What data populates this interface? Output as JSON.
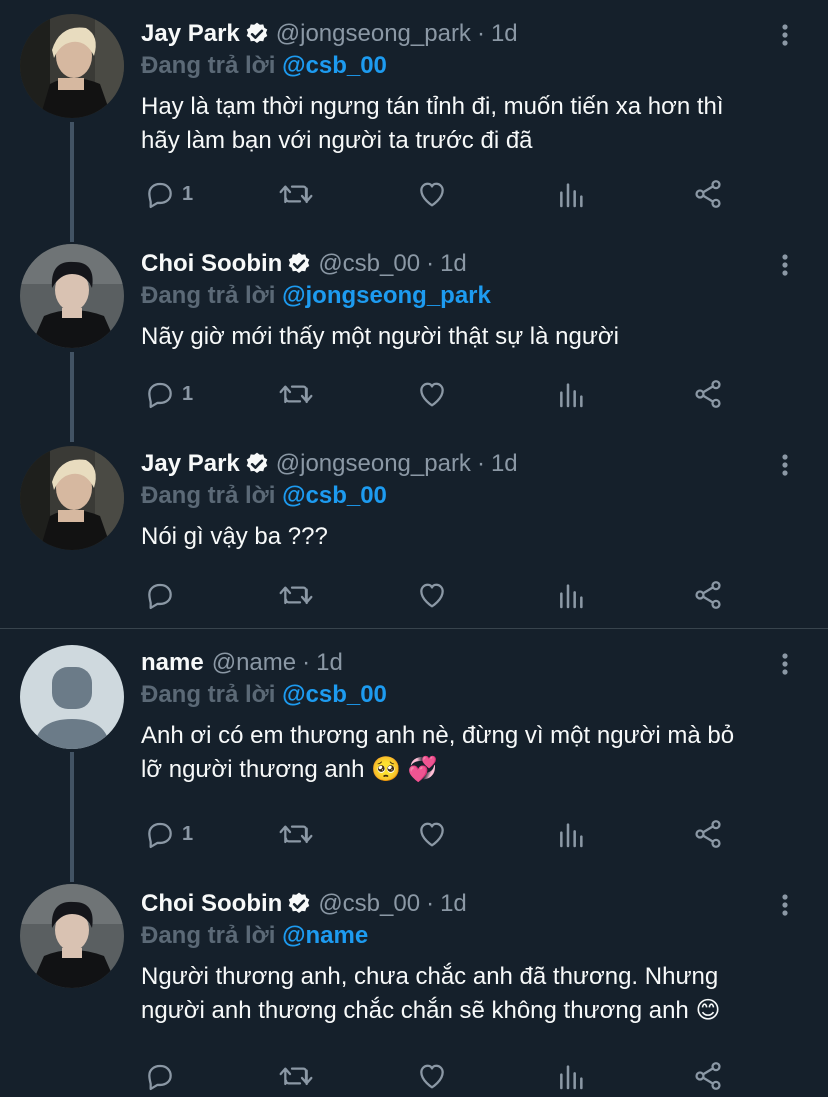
{
  "tweets": [
    {
      "name": "Jay Park",
      "handle": "@jongseong_park",
      "dot": "·",
      "time": "1d",
      "reply_prefix": "Đang trả lời",
      "reply_to": "@csb_00",
      "lines": [
        "Hay là tạm thời ngưng tán tỉnh đi, muốn tiến xa hơn thì",
        "hãy làm bạn với người ta trước đi đã"
      ],
      "reply_count": "1",
      "avatar": "blonde-man-avatar"
    },
    {
      "name": "Choi Soobin",
      "handle": "@csb_00",
      "dot": "·",
      "time": "1d",
      "reply_prefix": "Đang trả lời",
      "reply_to": "@jongseong_park",
      "lines": [
        "Nãy giờ mới thấy một người thật sự là người"
      ],
      "reply_count": "1",
      "avatar": "dark-hair-man-avatar"
    },
    {
      "name": "Jay Park",
      "handle": "@jongseong_park",
      "dot": "·",
      "time": "1d",
      "reply_prefix": "Đang trả lời",
      "reply_to": "@csb_00",
      "lines": [
        "Nói gì vậy ba ???"
      ],
      "reply_count": "",
      "avatar": "blonde-man-avatar"
    },
    {
      "name": "name",
      "handle": "@name",
      "dot": "·",
      "time": "1d",
      "reply_prefix": "Đang trả lời",
      "reply_to": "@csb_00",
      "lines": [
        "Anh ơi có em thương anh nè, đừng vì một người mà bỏ",
        "lỡ người thương anh 🥺 💞"
      ],
      "reply_count": "1",
      "avatar": "default-user-avatar"
    },
    {
      "name": "Choi Soobin",
      "handle": "@csb_00",
      "dot": "·",
      "time": "1d",
      "reply_prefix": "Đang trả lời",
      "reply_to": "@name",
      "lines": [
        "Người thương anh, chưa chắc anh đã thương. Nhưng",
        "người anh thương chắc chắn sẽ không thương anh 😊"
      ],
      "reply_count": "",
      "avatar": "dark-hair-man-avatar"
    }
  ],
  "colors": {
    "background": "#15202b",
    "text": "#f7f9f9",
    "secondary": "#8b98a5",
    "mention": "#1d9bf0",
    "thread_line": "#425364"
  }
}
